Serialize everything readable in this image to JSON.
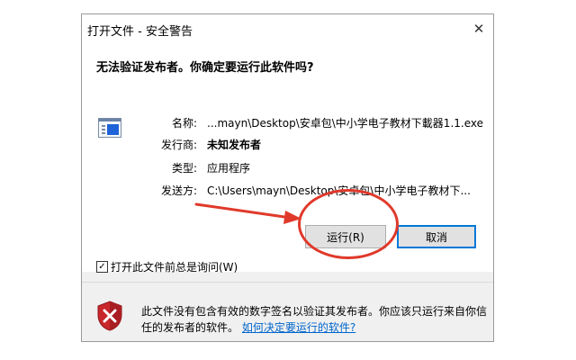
{
  "dialog": {
    "title": "打开文件 - 安全警告",
    "close_glyph": "✕",
    "heading": "无法验证发布者。你确定要运行此软件吗?",
    "fields": [
      {
        "label": "名称:",
        "value": "...mayn\\Desktop\\安卓包\\中小学电子教材下載器1.1.exe",
        "bold": false
      },
      {
        "label": "发行商:",
        "value": "未知发布者",
        "bold": true
      },
      {
        "label": "类型:",
        "value": "应用程序",
        "bold": false
      },
      {
        "label": "发送方:",
        "value": "C:\\Users\\mayn\\Desktop\\安卓包\\中小学电子教材下...",
        "bold": false
      }
    ],
    "run_button": "运行(R)",
    "cancel_button": "取消",
    "checkbox": {
      "label": "打开此文件前总是询问(W)",
      "checked": true
    },
    "warning": {
      "text": "此文件没有包含有效的数字签名以验证其发布者。你应该只运行来自你信任的发布者的软件。",
      "link": "如何决定要运行的软件?"
    }
  },
  "icons": {
    "file": "application-window-icon",
    "shield": "security-shield-error-icon"
  },
  "colors": {
    "accent": "#0078d7",
    "annotation": "#e0392b",
    "link": "#0066cc",
    "shield": "#c8272c"
  }
}
